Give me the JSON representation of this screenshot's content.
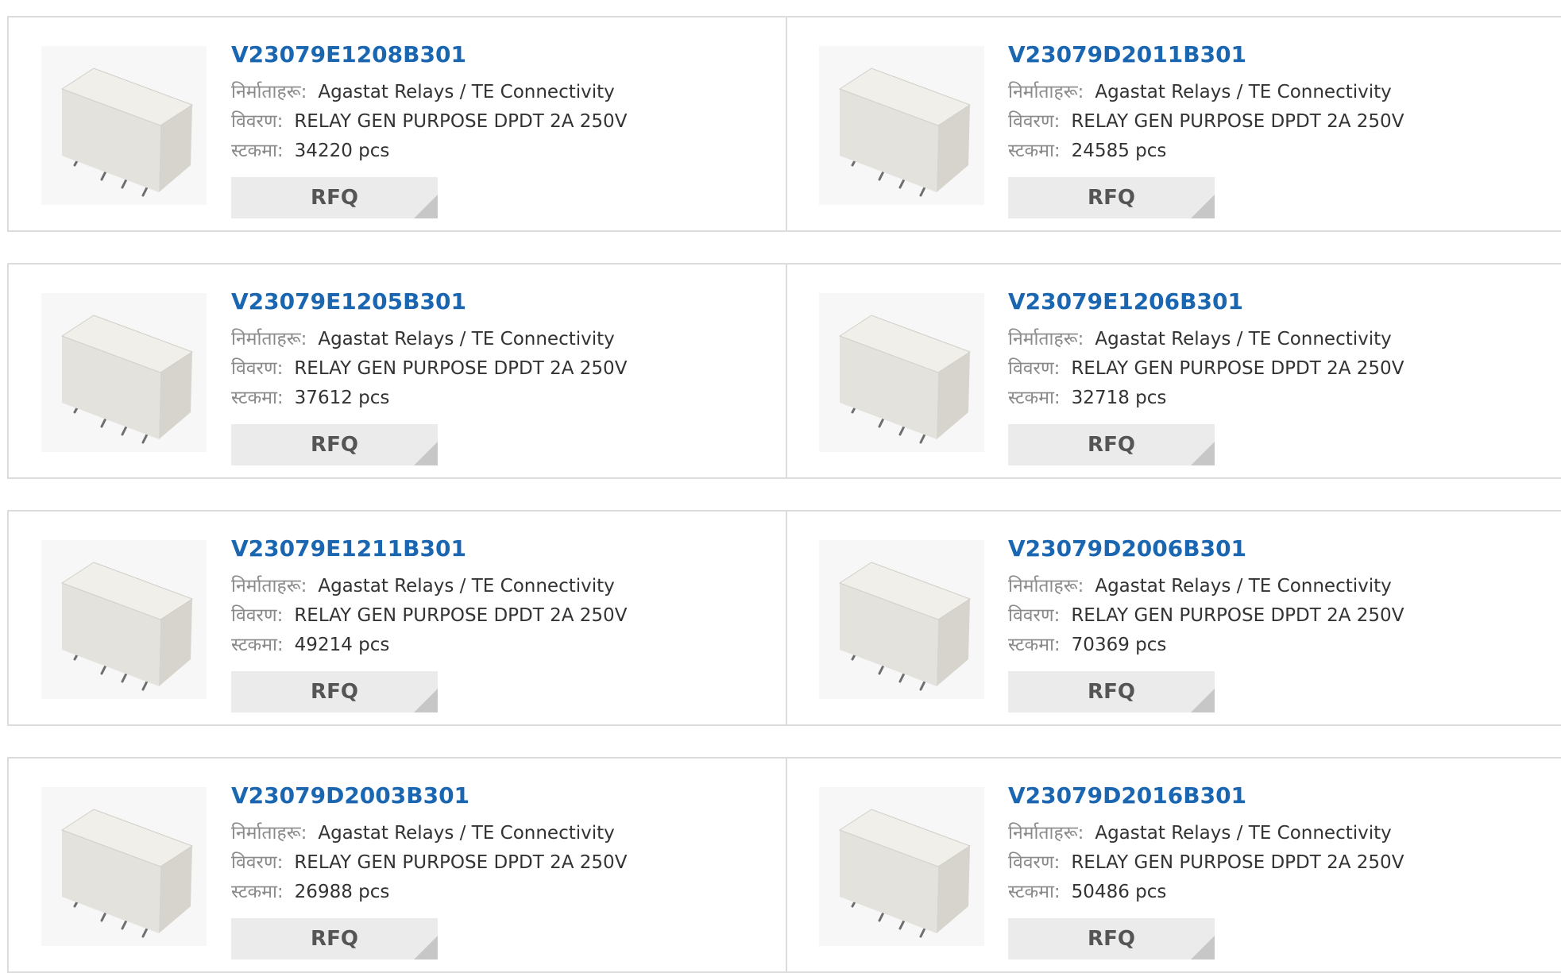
{
  "labels": {
    "manufacturer": "निर्माताहरू:",
    "description": "विवरण:",
    "stock": "स्टकमा:",
    "rfq": "RFQ"
  },
  "colors": {
    "part_link": "#1b66b1",
    "rfq_bg": "#ebebeb",
    "border": "#dcdcdc"
  },
  "products": [
    {
      "part": "V23079E1208B301",
      "manufacturer": "Agastat Relays / TE Connectivity",
      "description": "RELAY GEN PURPOSE DPDT 2A 250V",
      "stock": "34220 pcs"
    },
    {
      "part": "V23079D2011B301",
      "manufacturer": "Agastat Relays / TE Connectivity",
      "description": "RELAY GEN PURPOSE DPDT 2A 250V",
      "stock": "24585 pcs"
    },
    {
      "part": "V23079E1205B301",
      "manufacturer": "Agastat Relays / TE Connectivity",
      "description": "RELAY GEN PURPOSE DPDT 2A 250V",
      "stock": "37612 pcs"
    },
    {
      "part": "V23079E1206B301",
      "manufacturer": "Agastat Relays / TE Connectivity",
      "description": "RELAY GEN PURPOSE DPDT 2A 250V",
      "stock": "32718 pcs"
    },
    {
      "part": "V23079E1211B301",
      "manufacturer": "Agastat Relays / TE Connectivity",
      "description": "RELAY GEN PURPOSE DPDT 2A 250V",
      "stock": "49214 pcs"
    },
    {
      "part": "V23079D2006B301",
      "manufacturer": "Agastat Relays / TE Connectivity",
      "description": "RELAY GEN PURPOSE DPDT 2A 250V",
      "stock": "70369 pcs"
    },
    {
      "part": "V23079D2003B301",
      "manufacturer": "Agastat Relays / TE Connectivity",
      "description": "RELAY GEN PURPOSE DPDT 2A 250V",
      "stock": "26988 pcs"
    },
    {
      "part": "V23079D2016B301",
      "manufacturer": "Agastat Relays / TE Connectivity",
      "description": "RELAY GEN PURPOSE DPDT 2A 250V",
      "stock": "50486 pcs"
    }
  ]
}
